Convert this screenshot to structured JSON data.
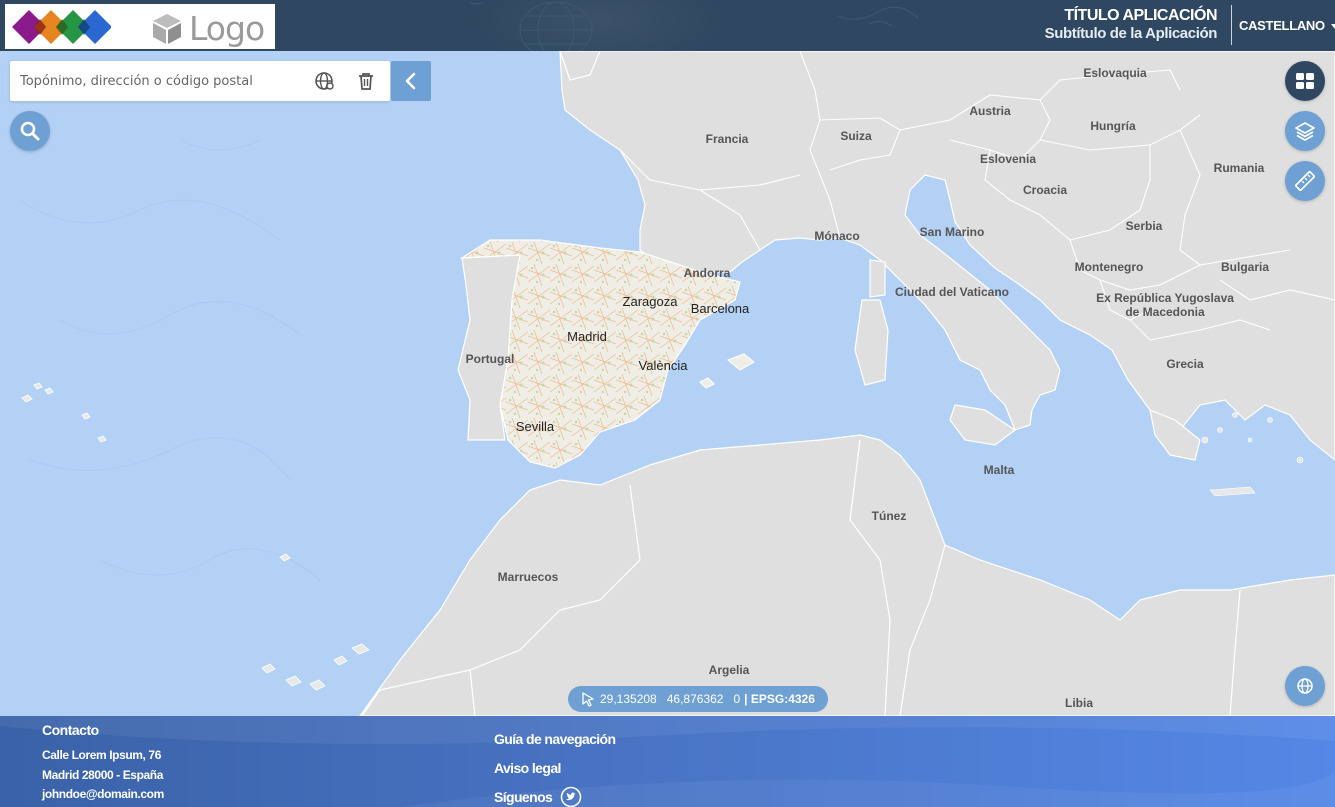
{
  "header": {
    "logo_text": "Logo",
    "app_title": "TÍTULO APLICACIÓN",
    "app_subtitle": "Subtítulo de la Aplicación",
    "language": "CASTELLANO",
    "logo_colors": [
      "#8b1a8a",
      "#e57d14",
      "#1a8f3a",
      "#1f5fcc"
    ]
  },
  "search": {
    "placeholder": "Topónimo, dirección o código postal",
    "value": ""
  },
  "map": {
    "countries": [
      "Francia",
      "Suiza",
      "Austria",
      "Eslovaquia",
      "Hungría",
      "Eslovenia",
      "Croacia",
      "Rumania",
      "Serbia",
      "Mónaco",
      "San Marino",
      "Andorra",
      "Bulgaria",
      "Montenegro",
      "Ciudad del Vaticano",
      "Ex República Yugoslava de Macedonia",
      "Portugal",
      "Grecia",
      "Malta",
      "Túnez",
      "Marruecos",
      "Argelia",
      "Libia"
    ],
    "cities": [
      "Zaragoza",
      "Barcelona",
      "Madrid",
      "València",
      "Sevilla"
    ],
    "colors": {
      "sea": "#b3d1f5",
      "land": "#dfdfdf",
      "spain": "#efeee6",
      "border": "#ffffff"
    }
  },
  "coordinates": {
    "x": "29,135208",
    "y": "46,876362",
    "z": "0",
    "epsg": "| EPSG:4326"
  },
  "footer": {
    "contact_heading": "Contacto",
    "address_line1": "Calle Lorem Ipsum, 76",
    "address_line2": "Madrid 28000 - España",
    "email": "johndoe@domain.com",
    "nav_guide": "Guía de navegación",
    "legal": "Aviso legal",
    "follow": "Síguenos",
    "colors": {
      "start": "#3a62a8",
      "end": "#5487e6"
    }
  },
  "icons": [
    "search-icon",
    "globe-icon",
    "trash-icon",
    "chevron-left-icon",
    "grid-icon",
    "layers-icon",
    "ruler-icon",
    "world-icon",
    "cursor-icon",
    "twitter-icon"
  ]
}
